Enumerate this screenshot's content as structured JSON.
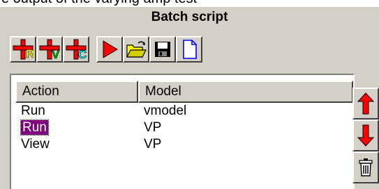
{
  "top_fragment": "e output of the varying amp test",
  "window": {
    "title": "Batch script"
  },
  "toolbar": {
    "buttons": [
      {
        "name": "add-run-button",
        "icon": "add-run-icon",
        "letter": "R",
        "letter_color": "#ffff00"
      },
      {
        "name": "add-view-button",
        "icon": "add-view-icon",
        "letter": "V",
        "letter_color": "#00c000"
      },
      {
        "name": "add-compare-button",
        "icon": "add-compare-icon",
        "letter": "C",
        "letter_color": "#00ffff"
      },
      {
        "name": "run-button",
        "icon": "play-icon"
      },
      {
        "name": "open-button",
        "icon": "folder-open-icon"
      },
      {
        "name": "save-button",
        "icon": "floppy-disk-icon"
      },
      {
        "name": "new-button",
        "icon": "new-document-icon"
      }
    ]
  },
  "table": {
    "columns": [
      "Action",
      "Model"
    ],
    "rows": [
      {
        "action": "Run",
        "model": "vmodel",
        "selected": false
      },
      {
        "action": "Run",
        "model": "VP",
        "selected": true
      },
      {
        "action": "View",
        "model": "VP",
        "selected": false
      }
    ]
  },
  "side_buttons": [
    {
      "name": "move-up-button",
      "icon": "arrow-up-icon"
    },
    {
      "name": "move-down-button",
      "icon": "arrow-down-icon"
    },
    {
      "name": "delete-button",
      "icon": "trash-icon"
    }
  ],
  "colors": {
    "background": "#d4d0c8",
    "selection": "#800080",
    "icon_red": "#ff0000",
    "icon_blue": "#0000ff"
  }
}
